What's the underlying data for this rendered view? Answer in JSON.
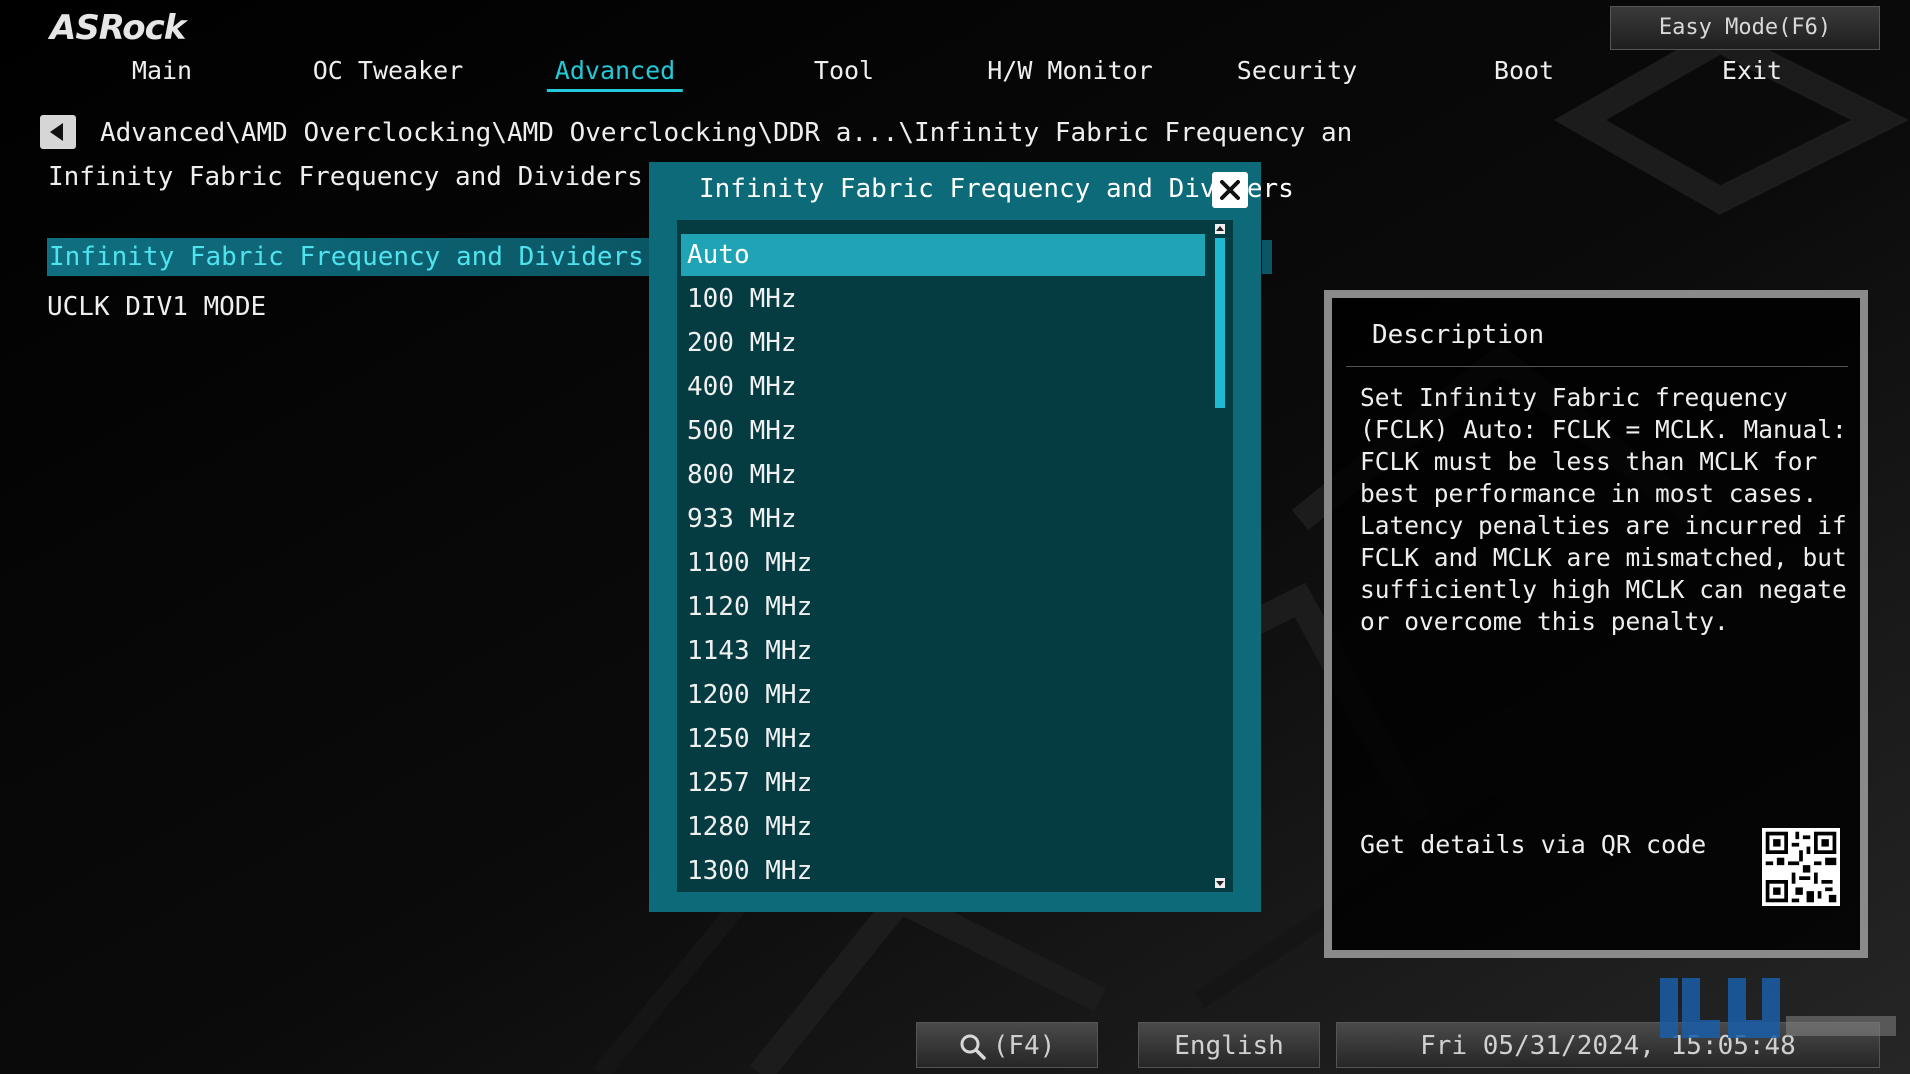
{
  "header": {
    "logo": "ASRock",
    "easy_mode_label": "Easy Mode(F6)"
  },
  "nav": {
    "tabs": [
      {
        "label": "Main"
      },
      {
        "label": "OC Tweaker"
      },
      {
        "label": "Advanced"
      },
      {
        "label": "Tool"
      },
      {
        "label": "H/W Monitor"
      },
      {
        "label": "Security"
      },
      {
        "label": "Boot"
      },
      {
        "label": "Exit"
      }
    ],
    "active": "Advanced"
  },
  "breadcrumb": "Advanced\\AMD Overclocking\\AMD Overclocking\\DDR a...\\Infinity Fabric Frequency an",
  "page_title": "Infinity Fabric Frequency and Dividers",
  "settings": [
    {
      "label": "Infinity Fabric Frequency and Dividers"
    },
    {
      "label": "UCLK DIV1 MODE"
    }
  ],
  "popup": {
    "title": "Infinity Fabric Frequency and Dividers",
    "options": [
      "Auto",
      "100 MHz",
      "200 MHz",
      "400 MHz",
      "500 MHz",
      "800 MHz",
      "933 MHz",
      "1100 MHz",
      "1120 MHz",
      "1143 MHz",
      "1200 MHz",
      "1250 MHz",
      "1257 MHz",
      "1280 MHz",
      "1300 MHz"
    ],
    "selected": "Auto"
  },
  "description": {
    "title": "Description",
    "text": "Set Infinity Fabric frequency (FCLK) Auto: FCLK = MCLK. Manual: FCLK must be less than MCLK for best performance in most cases. Latency penalties are incurred if FCLK and MCLK are mismatched, but sufficiently high MCLK can negate or overcome this penalty.",
    "qr_label": "Get details via QR code"
  },
  "footer": {
    "search_label": "(F4)",
    "language": "English",
    "datetime": "Fri 05/31/2024, 15:05:48"
  },
  "colors": {
    "accent": "#23c9d6",
    "popup_bg": "#0d6a78",
    "popup_list_bg": "#053c42",
    "selected_option": "#1fa3b5"
  }
}
